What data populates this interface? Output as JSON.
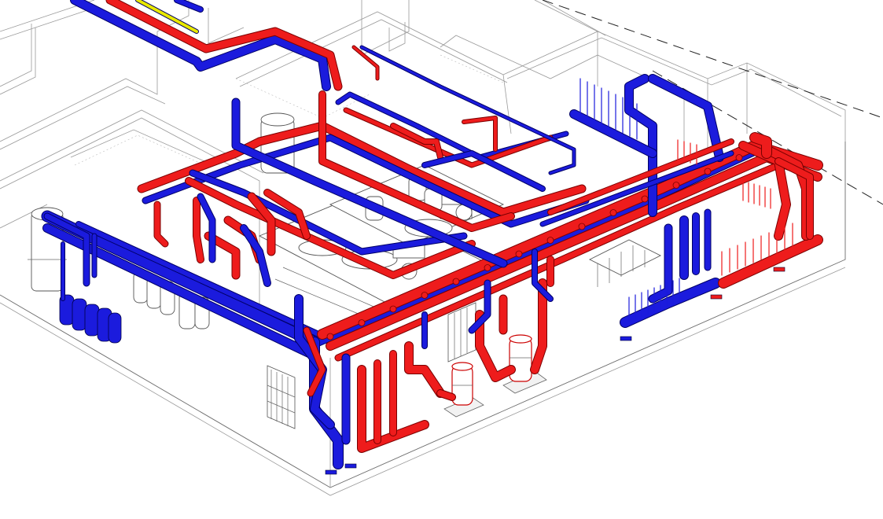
{
  "image": {
    "kind": "isometric-mechanical-room-3d-model",
    "background": "#ffffff",
    "colors": {
      "hot_pipe": "#ee1c1c",
      "hot_pipe_outline": "#7a0000",
      "cold_pipe": "#1b1bdd",
      "cold_pipe_outline": "#000066",
      "gas_pipe": "#e8e800",
      "wall_line": "#9a9a9a",
      "equipment_outline": "#555555"
    }
  },
  "legend_note": "",
  "systems": [
    {
      "name": "supply-hot-water",
      "color": "#ee1c1c"
    },
    {
      "name": "return-cold-water",
      "color": "#1b1bdd"
    },
    {
      "name": "gas-line",
      "color": "#e8e800"
    }
  ],
  "equipment": {
    "expansion_tanks": 5,
    "storage_tanks": 6,
    "circulation_pumps": 2,
    "plate_heat_exchangers": 2,
    "distribution_manifolds": 3
  }
}
